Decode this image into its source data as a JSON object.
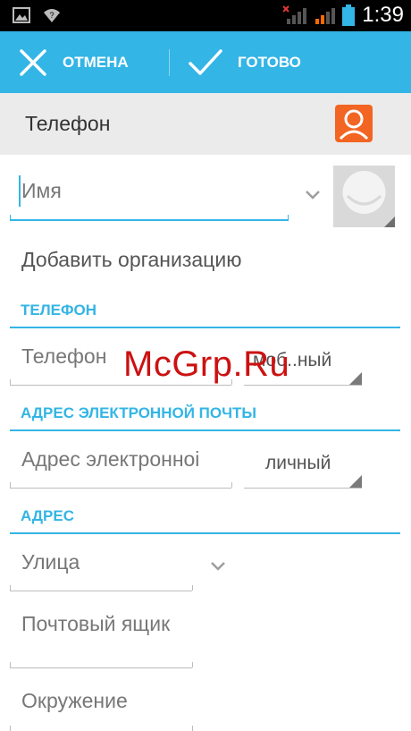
{
  "status_bar": {
    "time": "1:39"
  },
  "action_bar": {
    "cancel_label": "ОТМЕНА",
    "done_label": "ГОТОВО"
  },
  "account": {
    "label": "Телефон",
    "icon": "contact-account-icon"
  },
  "name_field": {
    "placeholder": "Имя"
  },
  "add_organization": "Добавить организацию",
  "phone_section": {
    "header": "ТЕЛЕФОН",
    "placeholder": "Телефон",
    "type": "моб..ный"
  },
  "email_section": {
    "header": "АДРЕС ЭЛЕКТРОННОЙ ПОЧТЫ",
    "placeholder": "Адрес электронноі",
    "type": "личный"
  },
  "address_section": {
    "header": "АДРЕС",
    "street_placeholder": "Улица",
    "pobox_placeholder": "Почтовый ящик",
    "neighborhood_placeholder": "Окружение"
  },
  "watermark": "McGrp.Ru",
  "colors": {
    "accent": "#33b5e5",
    "account_icon": "#f26522",
    "status_bar": "#000000"
  }
}
